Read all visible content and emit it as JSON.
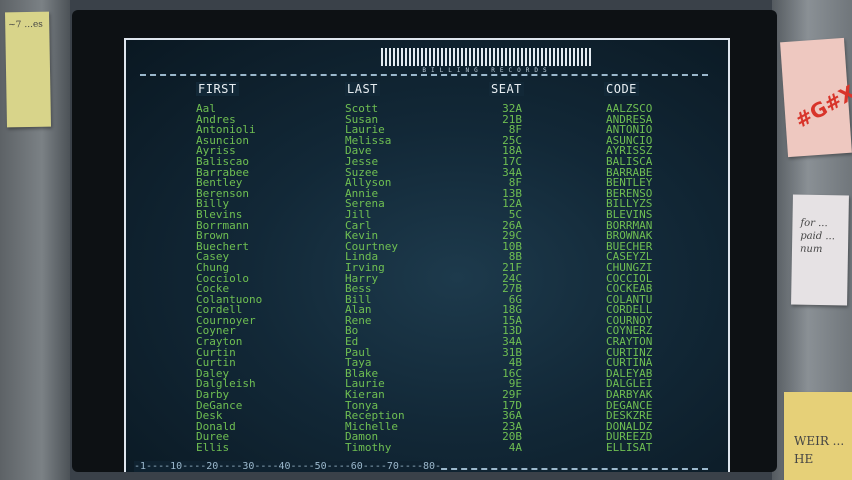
{
  "app": {
    "banner_text": "BILLING RECORDS"
  },
  "columns": {
    "first": "FIRST",
    "last": "LAST",
    "seat": "SEAT",
    "code": "CODE"
  },
  "records": [
    {
      "first": "Aal",
      "last": "Scott",
      "seat": "32A",
      "code": "AALZSCO"
    },
    {
      "first": "Andres",
      "last": "Susan",
      "seat": "21B",
      "code": "ANDRESA"
    },
    {
      "first": "Antonioli",
      "last": "Laurie",
      "seat": "8F",
      "code": "ANTONIO"
    },
    {
      "first": "Asuncion",
      "last": "Melissa",
      "seat": "25C",
      "code": "ASUNCIO"
    },
    {
      "first": "Ayriss",
      "last": "Dave",
      "seat": "18A",
      "code": "AYRISSZ"
    },
    {
      "first": "Baliscao",
      "last": "Jesse",
      "seat": "17C",
      "code": "BALISCA"
    },
    {
      "first": "Barrabee",
      "last": "Suzee",
      "seat": "34A",
      "code": "BARRABE"
    },
    {
      "first": "Bentley",
      "last": "Allyson",
      "seat": "8F",
      "code": "BENTLEY"
    },
    {
      "first": "Berenson",
      "last": "Annie",
      "seat": "13B",
      "code": "BERENSO"
    },
    {
      "first": "Billy",
      "last": "Serena",
      "seat": "12A",
      "code": "BILLYZS"
    },
    {
      "first": "Blevins",
      "last": "Jill",
      "seat": "5C",
      "code": "BLEVINS"
    },
    {
      "first": "Borrmann",
      "last": "Carl",
      "seat": "26A",
      "code": "BORRMAN"
    },
    {
      "first": "Brown",
      "last": "Kevin",
      "seat": "29C",
      "code": "BROWNAK"
    },
    {
      "first": "Buechert",
      "last": "Courtney",
      "seat": "10B",
      "code": "BUECHER"
    },
    {
      "first": "Casey",
      "last": "Linda",
      "seat": "8B",
      "code": "CASEYZL"
    },
    {
      "first": "Chung",
      "last": "Irving",
      "seat": "21F",
      "code": "CHUNGZI"
    },
    {
      "first": "Cocciolo",
      "last": "Harry",
      "seat": "24C",
      "code": "COCCIOL"
    },
    {
      "first": "Cocke",
      "last": "Bess",
      "seat": "27B",
      "code": "COCKEAB"
    },
    {
      "first": "Colantuono",
      "last": "Bill",
      "seat": "6G",
      "code": "COLANTU"
    },
    {
      "first": "Cordell",
      "last": "Alan",
      "seat": "18G",
      "code": "CORDELL"
    },
    {
      "first": "Cournoyer",
      "last": "Rene",
      "seat": "15A",
      "code": "COURNOY"
    },
    {
      "first": "Coyner",
      "last": "Bo",
      "seat": "13D",
      "code": "COYNERZ"
    },
    {
      "first": "Crayton",
      "last": "Ed",
      "seat": "34A",
      "code": "CRAYTON"
    },
    {
      "first": "Curtin",
      "last": "Paul",
      "seat": "31B",
      "code": "CURTINZ"
    },
    {
      "first": "Curtin",
      "last": "Taya",
      "seat": "4B",
      "code": "CURTINA"
    },
    {
      "first": "Daley",
      "last": "Blake",
      "seat": "16C",
      "code": "DALEYAB"
    },
    {
      "first": "Dalgleish",
      "last": "Laurie",
      "seat": "9E",
      "code": "DALGLEI"
    },
    {
      "first": "Darby",
      "last": "Kieran",
      "seat": "29F",
      "code": "DARBYAK"
    },
    {
      "first": "DeGance",
      "last": "Tonya",
      "seat": "17D",
      "code": "DEGANCE"
    },
    {
      "first": "Desk",
      "last": "Reception",
      "seat": "36A",
      "code": "DESKZRE"
    },
    {
      "first": "Donald",
      "last": "Michelle",
      "seat": "23A",
      "code": "DONALDZ"
    },
    {
      "first": "Duree",
      "last": "Damon",
      "seat": "20B",
      "code": "DUREEZD"
    },
    {
      "first": "Ellis",
      "last": "Timothy",
      "seat": "4A",
      "code": "ELLISAT"
    }
  ],
  "ruler": "-1----10----20----30----40----50----60----70----80-",
  "notes": {
    "left": "~7 ...es",
    "pink": "#G#X",
    "white": "for ... paid ... num",
    "yellow": "WEIR ... HE"
  }
}
